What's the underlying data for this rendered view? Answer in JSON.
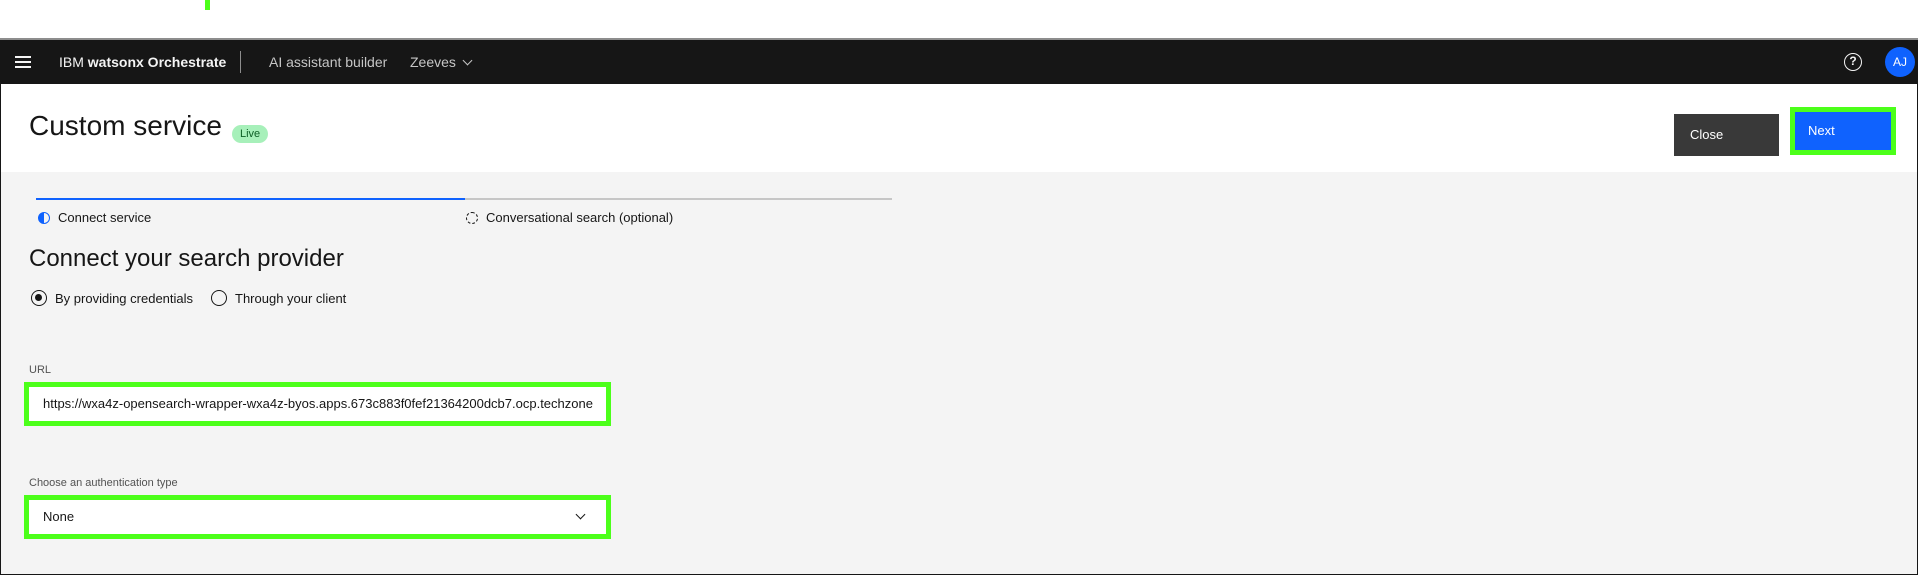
{
  "header": {
    "brand_prefix": "IBM",
    "brand_name": "watsonx Orchestrate",
    "nav": [
      "AI assistant builder",
      "Zeeves"
    ],
    "avatar_initials": "AJ",
    "help_glyph": "?"
  },
  "page": {
    "title": "Custom service",
    "badge": "Live",
    "close_label": "Close",
    "next_label": "Next"
  },
  "steps": [
    {
      "label": "Connect service",
      "state": "in-progress"
    },
    {
      "label": "Conversational search (optional)",
      "state": "not-started"
    }
  ],
  "progress_fraction": 0.5,
  "section": {
    "title": "Connect your search provider",
    "options": [
      {
        "label": "By providing credentials",
        "selected": true
      },
      {
        "label": "Through your client",
        "selected": false
      }
    ]
  },
  "url_field": {
    "label": "URL",
    "value": "https://wxa4z-opensearch-wrapper-wxa4z-byos.apps.673c883f0fef21364200dcb7.ocp.techzone"
  },
  "auth_field": {
    "label": "Choose an authentication type",
    "value": "None"
  },
  "colors": {
    "header_bg": "#161616",
    "primary": "#0f62fe",
    "highlight": "#4cff1a",
    "badge_bg": "#a7f0ba"
  },
  "icons": [
    "hamburger-menu-icon",
    "chevron-down-icon",
    "help-icon",
    "step-in-progress-icon",
    "step-incomplete-icon"
  ]
}
